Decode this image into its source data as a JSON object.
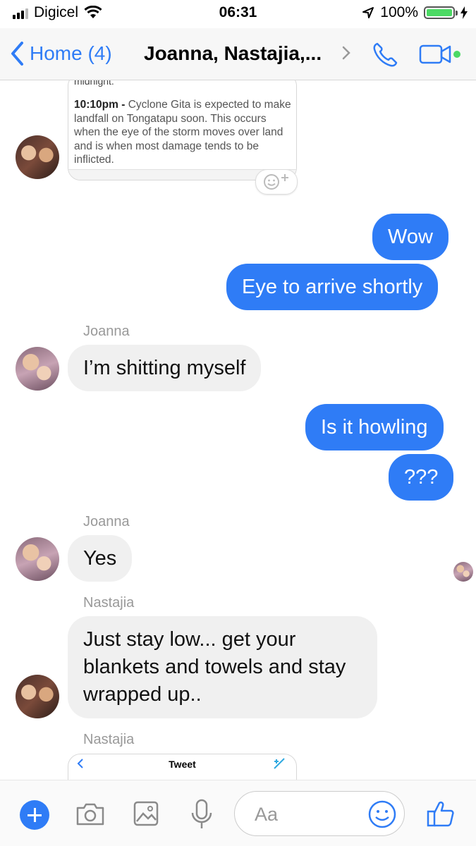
{
  "status_bar": {
    "carrier": "Digicel",
    "time": "06:31",
    "battery_percent": "100%",
    "battery_level": 1.0
  },
  "nav": {
    "back_label": "Home (4)",
    "title": "Joanna, Nastajia,...",
    "accent_color": "#2f7cf6",
    "active_dot_color": "#4cd964"
  },
  "shared_card": {
    "cut_text": "midnight.",
    "time": "10:10pm -",
    "text": "Cyclone Gita is expected to make landfall on Tongatapu soon. This occurs when the eye of the storm moves over land and is when most damage tends to be inflicted."
  },
  "messages": [
    {
      "text": "Wow"
    },
    {
      "text": "Eye to arrive shortly"
    },
    {
      "sender": "Joanna",
      "text": "I’m shitting myself"
    },
    {
      "text": "Is it howling"
    },
    {
      "text": "???"
    },
    {
      "sender": "Joanna",
      "text": "Yes"
    },
    {
      "sender": "Nastajia",
      "line1": "Just stay low... get your",
      "line2": "blankets and towels and stay",
      "line3": "wrapped up.."
    },
    {
      "sender": "Nastajia"
    }
  ],
  "tweet_card": {
    "title": "Tweet"
  },
  "composer": {
    "placeholder": "Aa"
  },
  "colors": {
    "outgoing_bubble": "#2f7cf6",
    "incoming_bubble": "#f0f0f0"
  }
}
